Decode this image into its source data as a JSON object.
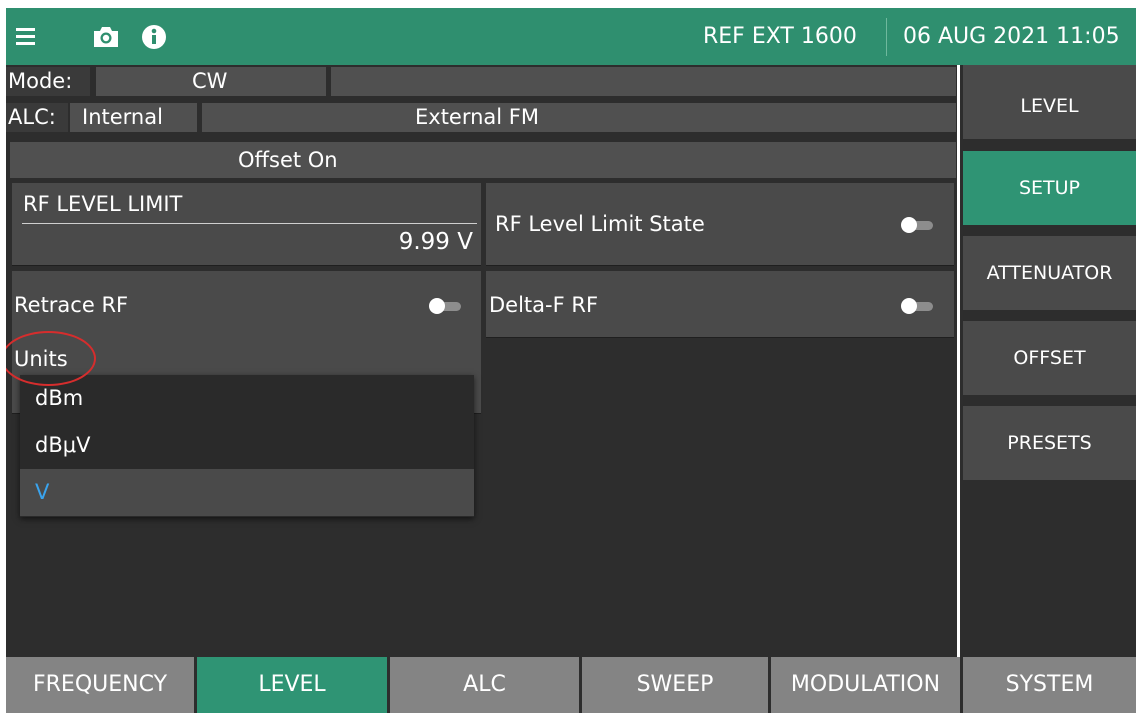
{
  "topbar": {
    "icons": [
      "menu-icon",
      "camera-icon",
      "info-icon"
    ],
    "reference": "REF EXT 1600",
    "datetime": "06 AUG 2021 11:05"
  },
  "status": {
    "mode_label": "Mode:",
    "mode_value": "CW",
    "alc_label": "ALC:",
    "alc_value": "Internal",
    "alc_fm": "External FM",
    "offset": "Offset On"
  },
  "settings": {
    "rf_level_limit_label": "RF LEVEL LIMIT",
    "rf_level_limit_value": "9.99 V",
    "rf_level_limit_state_label": "RF Level Limit State",
    "rf_level_limit_state_on": false,
    "retrace_rf_label": "Retrace RF",
    "retrace_rf_on": false,
    "delta_f_rf_label": "Delta-F RF",
    "delta_f_rf_on": false,
    "units_label": "Units"
  },
  "units_dropdown": {
    "options": [
      "dBm",
      "dBμV",
      "V"
    ],
    "selected": "V"
  },
  "side_menu": {
    "items": [
      "LEVEL",
      "SETUP",
      "ATTENUATOR",
      "OFFSET",
      "PRESETS"
    ],
    "active": "SETUP"
  },
  "bottom_tabs": {
    "items": [
      "FREQUENCY",
      "LEVEL",
      "ALC",
      "SWEEP",
      "MODULATION",
      "SYSTEM"
    ],
    "active": "LEVEL"
  },
  "colors": {
    "accent": "#2f9474",
    "topbar": "#2f8f6f",
    "selected_text": "#3aa4ee",
    "annotation_circle": "#d62d2d"
  }
}
